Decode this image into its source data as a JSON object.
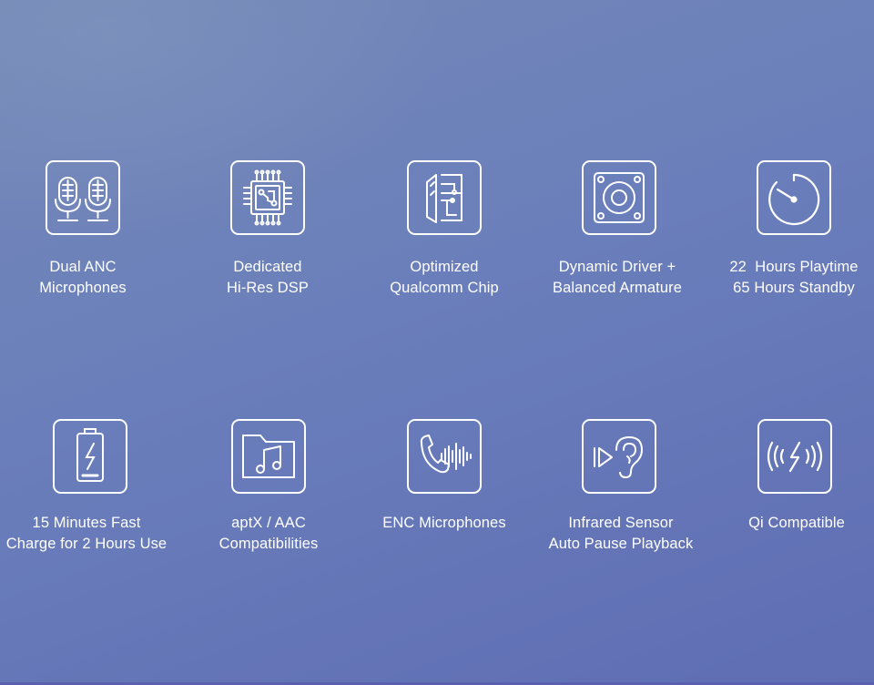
{
  "features": [
    {
      "icon": "dual-microphone-icon",
      "lines": [
        "Dual ANC",
        "Microphones"
      ]
    },
    {
      "icon": "dsp-chip-icon",
      "lines": [
        "Dedicated",
        "Hi-Res DSP"
      ]
    },
    {
      "icon": "qualcomm-chip-icon",
      "lines": [
        "Optimized",
        "Qualcomm Chip"
      ]
    },
    {
      "icon": "speaker-driver-icon",
      "lines": [
        "Dynamic Driver +",
        "Balanced Armature"
      ]
    },
    {
      "icon": "timer-icon",
      "lines": [
        "22  Hours Playtime",
        "65 Hours Standby"
      ]
    },
    {
      "icon": "battery-charge-icon",
      "lines": [
        "15 Minutes Fast",
        "Charge for 2 Hours Use"
      ]
    },
    {
      "icon": "music-folder-icon",
      "lines": [
        "aptX / AAC",
        "Compatibilities"
      ]
    },
    {
      "icon": "phone-soundwave-icon",
      "lines": [
        "ENC Microphones"
      ]
    },
    {
      "icon": "ear-sensor-icon",
      "lines": [
        "Infrared Sensor",
        "Auto Pause Playback"
      ]
    },
    {
      "icon": "wireless-charging-icon",
      "lines": [
        "Qi Compatible"
      ]
    }
  ]
}
